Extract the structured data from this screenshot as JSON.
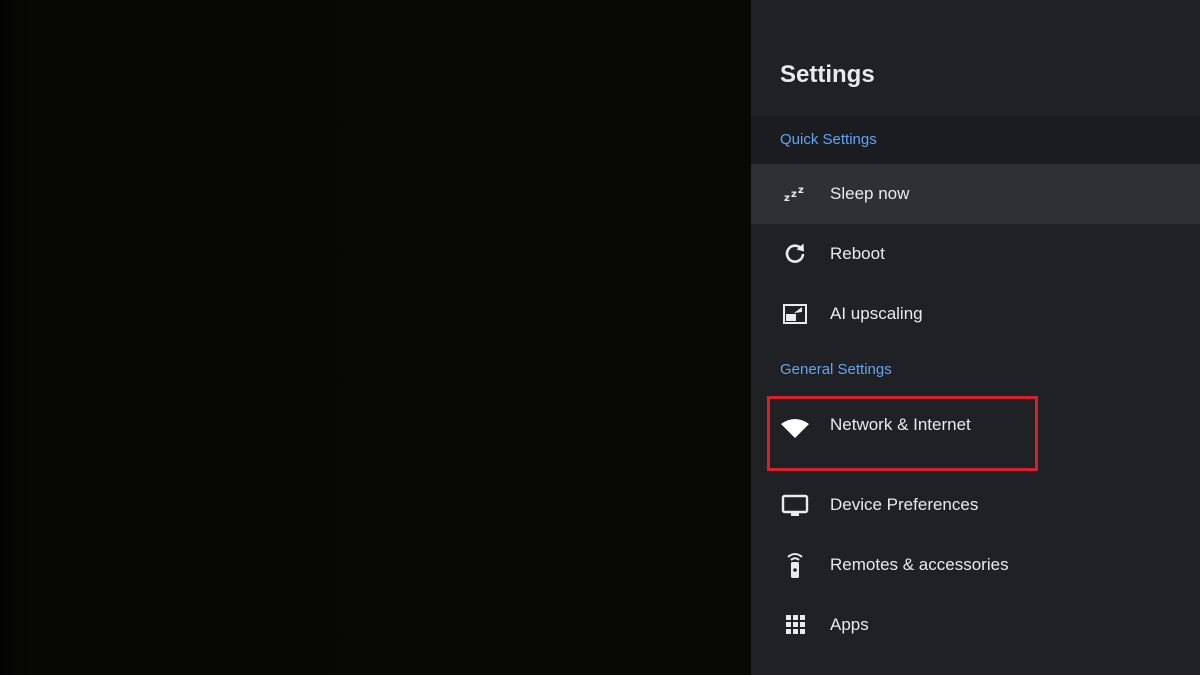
{
  "settings_panel": {
    "title": "Settings",
    "quick_settings": {
      "header": "Quick Settings",
      "items": [
        {
          "label": "Sleep now",
          "icon": "sleep-icon",
          "focused": true
        },
        {
          "label": "Reboot",
          "icon": "reboot-icon"
        },
        {
          "label": "AI upscaling",
          "icon": "ai-upscaling-icon"
        }
      ]
    },
    "general_settings": {
      "header": "General Settings",
      "items": [
        {
          "label": "Network & Internet",
          "icon": "wifi-icon",
          "highlighted": true
        },
        {
          "label": "Device Preferences",
          "icon": "tv-icon"
        },
        {
          "label": "Remotes & accessories",
          "icon": "remote-icon"
        },
        {
          "label": "Apps",
          "icon": "apps-grid-icon"
        }
      ]
    }
  },
  "colors": {
    "panel_background": "#202124",
    "section_header": "#5fa5f5",
    "focused_row": "#2f3034",
    "highlight_border": "#d7202c",
    "text": "#e8eaed"
  }
}
